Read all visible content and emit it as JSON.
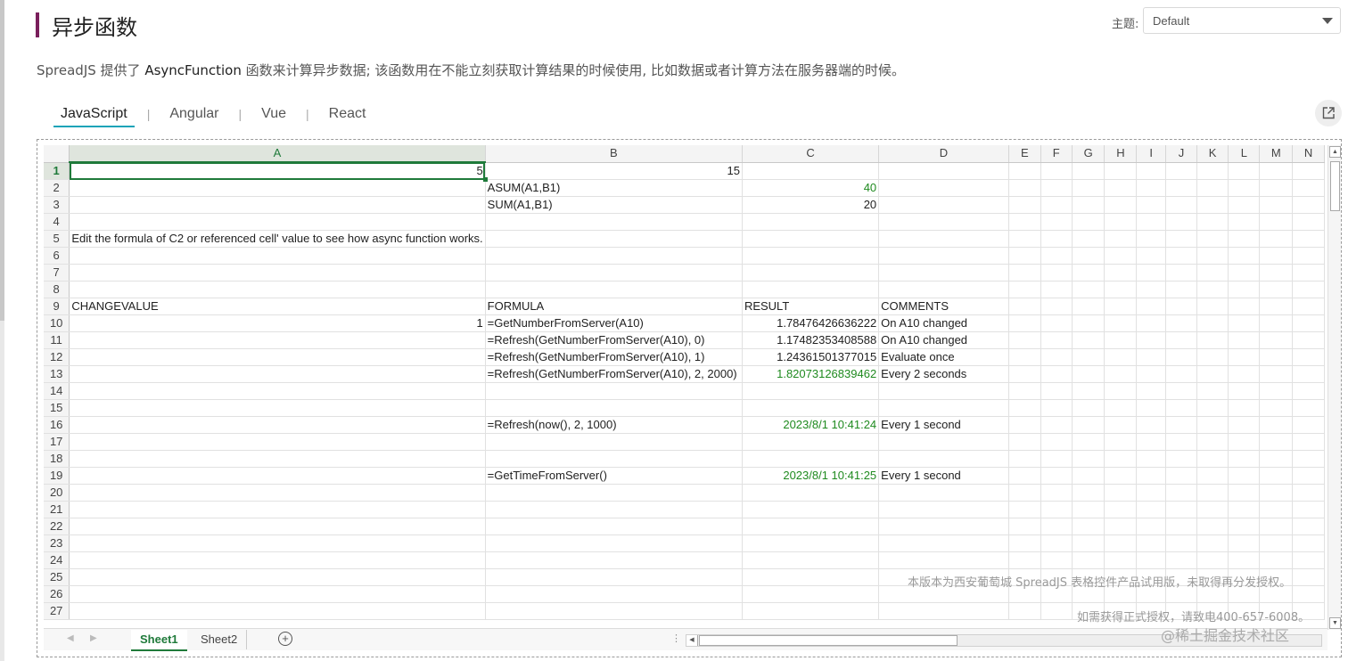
{
  "header": {
    "title": "异步函数",
    "theme_label": "主题:",
    "theme_value": "Default",
    "accent_color": "#7a1f5c"
  },
  "description": {
    "prefix": "SpreadJS 提供了 ",
    "highlight": "AsyncFunction",
    "suffix": " 函数来计算异步数据; 该函数用在不能立刻获取计算结果的时候使用, 比如数据或者计算方法在服务器端的时候。"
  },
  "tabs": [
    "JavaScript",
    "Angular",
    "Vue",
    "React"
  ],
  "tabs_active": "JavaScript",
  "open_button_icon": "external-link-icon",
  "spreadsheet": {
    "columns": [
      "A",
      "B",
      "C",
      "D",
      "E",
      "F",
      "G",
      "H",
      "I",
      "J",
      "K",
      "L",
      "M",
      "N"
    ],
    "selected_column": "A",
    "selected_row": "1",
    "rows": [
      {
        "n": "1",
        "A": "5",
        "B": "15",
        "C": "",
        "D": ""
      },
      {
        "n": "2",
        "A": "",
        "B": "ASUM(A1,B1)",
        "C": "40",
        "D": ""
      },
      {
        "n": "3",
        "A": "",
        "B": "SUM(A1,B1)",
        "C": "20",
        "D": ""
      },
      {
        "n": "4",
        "A": "",
        "B": "",
        "C": "",
        "D": ""
      },
      {
        "n": "5",
        "A": "Edit the formula of C2 or referenced cell' value to see how async function works.",
        "B": "",
        "C": "",
        "D": ""
      },
      {
        "n": "6",
        "A": "",
        "B": "",
        "C": "",
        "D": ""
      },
      {
        "n": "7",
        "A": "",
        "B": "",
        "C": "",
        "D": ""
      },
      {
        "n": "8",
        "A": "",
        "B": "",
        "C": "",
        "D": ""
      },
      {
        "n": "9",
        "A": "CHANGEVALUE",
        "B": "FORMULA",
        "C": "RESULT",
        "D": "COMMENTS"
      },
      {
        "n": "10",
        "A": "1",
        "B": "=GetNumberFromServer(A10)",
        "C": "1.78476426636222",
        "D": "On A10 changed"
      },
      {
        "n": "11",
        "A": "",
        "B": "=Refresh(GetNumberFromServer(A10), 0)",
        "C": "1.17482353408588",
        "D": "On A10 changed"
      },
      {
        "n": "12",
        "A": "",
        "B": "=Refresh(GetNumberFromServer(A10), 1)",
        "C": "1.24361501377015",
        "D": "Evaluate once"
      },
      {
        "n": "13",
        "A": "",
        "B": "=Refresh(GetNumberFromServer(A10), 2, 2000)",
        "C": "1.82073126839462",
        "D": "Every 2 seconds"
      },
      {
        "n": "14",
        "A": "",
        "B": "",
        "C": "",
        "D": ""
      },
      {
        "n": "15",
        "A": "",
        "B": "",
        "C": "",
        "D": ""
      },
      {
        "n": "16",
        "A": "",
        "B": "=Refresh(now(), 2, 1000)",
        "C": "2023/8/1 10:41:24",
        "D": "Every 1 second"
      },
      {
        "n": "17",
        "A": "",
        "B": "",
        "C": "",
        "D": ""
      },
      {
        "n": "18",
        "A": "",
        "B": "",
        "C": "",
        "D": ""
      },
      {
        "n": "19",
        "A": "",
        "B": "=GetTimeFromServer()",
        "C": "2023/8/1 10:41:25",
        "D": "Every 1 second"
      },
      {
        "n": "20",
        "A": "",
        "B": "",
        "C": "",
        "D": ""
      },
      {
        "n": "21",
        "A": "",
        "B": "",
        "C": "",
        "D": ""
      },
      {
        "n": "22",
        "A": "",
        "B": "",
        "C": "",
        "D": ""
      },
      {
        "n": "23",
        "A": "",
        "B": "",
        "C": "",
        "D": ""
      },
      {
        "n": "24",
        "A": "",
        "B": "",
        "C": "",
        "D": ""
      },
      {
        "n": "25",
        "A": "",
        "B": "",
        "C": "",
        "D": ""
      },
      {
        "n": "26",
        "A": "",
        "B": "",
        "C": "",
        "D": ""
      },
      {
        "n": "27",
        "A": "",
        "B": "",
        "C": "",
        "D": ""
      }
    ],
    "green_cells": [
      "C2",
      "C13",
      "C16",
      "C19"
    ],
    "sheet_tabs": [
      "Sheet1",
      "Sheet2"
    ],
    "active_sheet": "Sheet1",
    "add_sheet_icon": "plus-circle-icon",
    "more_icon": "vertical-dots-icon",
    "green_color": "#1f8a1f"
  },
  "watermark": {
    "line1": "本版本为西安葡萄城 SpreadJS 表格控件产品试用版，未取得再分发授权。",
    "line2": "如需获得正式授权，请致电400-657-6008。"
  },
  "footer_mark": "@稀土掘金技术社区"
}
